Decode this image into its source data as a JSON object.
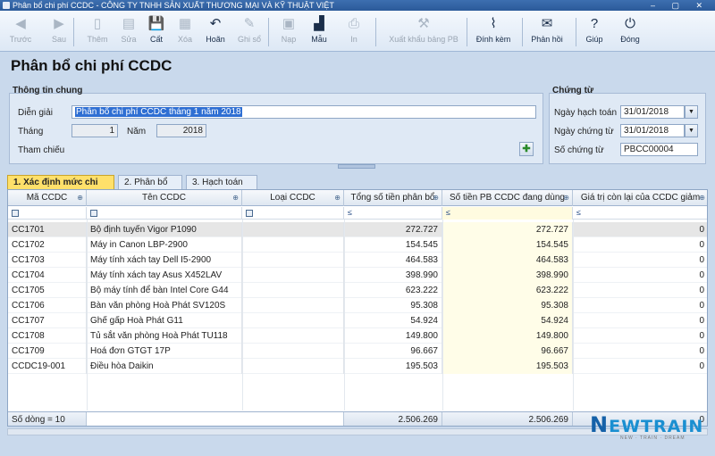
{
  "window": {
    "title": "Phân bổ chi phí CCDC - CÔNG TY TNHH SẢN XUẤT THƯƠNG MẠI VÀ KỸ THUẬT VIỆT",
    "controls": "– ▢ ✕"
  },
  "toolbar": {
    "items": [
      {
        "label": "Trước",
        "icon": "◀",
        "icon_name": "arrow-left-icon",
        "enabled": false
      },
      {
        "label": "Sau",
        "icon": "▶",
        "icon_name": "arrow-right-icon",
        "enabled": false
      },
      {
        "label": "Thêm",
        "icon": "▯",
        "icon_name": "new-document-icon",
        "enabled": false
      },
      {
        "label": "Sửa",
        "icon": "▤",
        "icon_name": "edit-document-icon",
        "enabled": false
      },
      {
        "label": "Cất",
        "icon": "💾",
        "icon_name": "save-icon",
        "enabled": true
      },
      {
        "label": "Xóa",
        "icon": "▦",
        "icon_name": "delete-icon",
        "enabled": false
      },
      {
        "label": "Hoãn",
        "icon": "↶",
        "icon_name": "undo-icon",
        "enabled": true
      },
      {
        "label": "Ghi sổ",
        "icon": "✎",
        "icon_name": "post-ledger-icon",
        "enabled": false
      },
      {
        "label": "Nạp",
        "icon": "▣",
        "icon_name": "reload-icon",
        "enabled": false
      },
      {
        "label": "Mẫu",
        "icon": "▟",
        "icon_name": "template-icon",
        "enabled": true
      },
      {
        "label": "In",
        "icon": "⎙",
        "icon_name": "print-icon",
        "enabled": false
      },
      {
        "label": "Xuất khẩu bảng PB",
        "icon": "⚒",
        "icon_name": "export-icon",
        "enabled": false
      },
      {
        "label": "Đính kèm",
        "icon": "⌇",
        "icon_name": "attach-icon",
        "enabled": true
      },
      {
        "label": "Phản hồi",
        "icon": "✉",
        "icon_name": "feedback-icon",
        "enabled": true
      },
      {
        "label": "Giúp",
        "icon": "?",
        "icon_name": "help-icon",
        "enabled": true
      },
      {
        "label": "Đóng",
        "icon": "⏻",
        "icon_name": "close-icon",
        "enabled": true
      }
    ]
  },
  "page": {
    "title": "Phân bổ chi phí CCDC"
  },
  "general": {
    "title": "Thông tin chung",
    "description_label": "Diễn giải",
    "description_value": "Phân bổ chi phí CCDC tháng 1 năm 2018",
    "month_label": "Tháng",
    "month_value": "1",
    "year_label": "Năm",
    "year_value": "2018",
    "reference_label": "Tham chiếu",
    "add_icon": "✚"
  },
  "voucher": {
    "title": "Chứng từ",
    "posting_date_label": "Ngày hạch toán",
    "posting_date_value": "31/01/2018",
    "voucher_date_label": "Ngày chứng từ",
    "voucher_date_value": "31/01/2018",
    "voucher_no_label": "Số chứng từ",
    "voucher_no_value": "PBCC00004",
    "dropdown_icon": "▼"
  },
  "tabs": [
    {
      "label": "1. Xác định mức chi phí",
      "active": true
    },
    {
      "label": "2. Phân bổ",
      "active": false
    },
    {
      "label": "3. Hạch toán",
      "active": false
    }
  ],
  "grid": {
    "columns": [
      "Mã CCDC",
      "Tên CCDC",
      "Loại CCDC",
      "Tổng số tiền phân bổ",
      "Số tiền PB CCDC đang dùng",
      "Giá trị còn lại của CCDC giảm"
    ],
    "pin_icon": "⊕",
    "filter_ops": [
      "",
      "",
      "",
      "≤",
      "≤",
      "≤"
    ],
    "rows": [
      {
        "code": "CC1701",
        "name": "Bộ định tuyến Vigor P1090",
        "type": "",
        "total": "272.727",
        "in_use": "272.727",
        "remaining": "0"
      },
      {
        "code": "CC1702",
        "name": "Máy in Canon LBP-2900",
        "type": "",
        "total": "154.545",
        "in_use": "154.545",
        "remaining": "0"
      },
      {
        "code": "CC1703",
        "name": "Máy tính xách tay Dell I5-2900",
        "type": "",
        "total": "464.583",
        "in_use": "464.583",
        "remaining": "0"
      },
      {
        "code": "CC1704",
        "name": "Máy tính xách tay Asus X452LAV",
        "type": "",
        "total": "398.990",
        "in_use": "398.990",
        "remaining": "0"
      },
      {
        "code": "CC1705",
        "name": "Bộ máy tính để bàn Intel Core G44",
        "type": "",
        "total": "623.222",
        "in_use": "623.222",
        "remaining": "0"
      },
      {
        "code": "CC1706",
        "name": "Bàn văn phòng Hoà Phát SV120S",
        "type": "",
        "total": "95.308",
        "in_use": "95.308",
        "remaining": "0"
      },
      {
        "code": "CC1707",
        "name": "Ghế gấp Hoà Phát G11",
        "type": "",
        "total": "54.924",
        "in_use": "54.924",
        "remaining": "0"
      },
      {
        "code": "CC1708",
        "name": "Tủ sắt văn phòng Hoà Phát TU118",
        "type": "",
        "total": "149.800",
        "in_use": "149.800",
        "remaining": "0"
      },
      {
        "code": "CC1709",
        "name": "Hoá đơn GTGT 17P",
        "type": "",
        "total": "96.667",
        "in_use": "96.667",
        "remaining": "0"
      },
      {
        "code": "CCDC19-001",
        "name": "Điều hòa Daikin",
        "type": "",
        "total": "195.503",
        "in_use": "195.503",
        "remaining": "0"
      }
    ],
    "footer": {
      "row_count": "Số dòng = 10",
      "total": "2.506.269",
      "in_use": "2.506.269",
      "remaining": "0"
    }
  },
  "logo": {
    "brand_n": "N",
    "brand_rest": "EWTRAIN",
    "tagline": "NEW · TRAIN · DREAM"
  },
  "colors": {
    "accent": "#2f6fd3",
    "active_tab": "#ffe06a",
    "brand": "#1a8fd1"
  }
}
